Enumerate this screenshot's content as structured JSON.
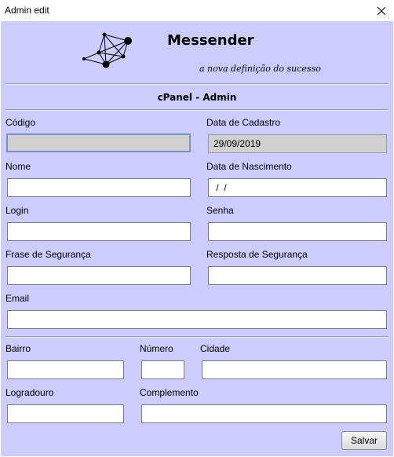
{
  "window": {
    "title": "Admin edit"
  },
  "header": {
    "app_name": "Messender",
    "tagline": "a nova definição do sucesso",
    "section_title": "cPanel - Admin"
  },
  "form": {
    "codigo": {
      "label": "Código",
      "value": ""
    },
    "data_cadastro": {
      "label": "Data de Cadastro",
      "value": "29/09/2019"
    },
    "nome": {
      "label": "Nome",
      "value": ""
    },
    "data_nascimento": {
      "label": "Data de Nascimento",
      "value": " /  /"
    },
    "login": {
      "label": "Login",
      "value": ""
    },
    "senha": {
      "label": "Senha",
      "value": ""
    },
    "frase_seguranca": {
      "label": "Frase de Segurança",
      "value": ""
    },
    "resposta_seguranca": {
      "label": "Resposta de Segurança",
      "value": ""
    },
    "email": {
      "label": "Email",
      "value": ""
    },
    "bairro": {
      "label": "Bairro",
      "value": ""
    },
    "numero": {
      "label": "Número",
      "value": ""
    },
    "cidade": {
      "label": "Cidade",
      "value": ""
    },
    "logradouro": {
      "label": "Logradouro",
      "value": ""
    },
    "complemento": {
      "label": "Complemento",
      "value": ""
    }
  },
  "buttons": {
    "save_label": "Salvar"
  },
  "icons": {
    "close": "close-icon",
    "logo": "network-logo-icon"
  }
}
